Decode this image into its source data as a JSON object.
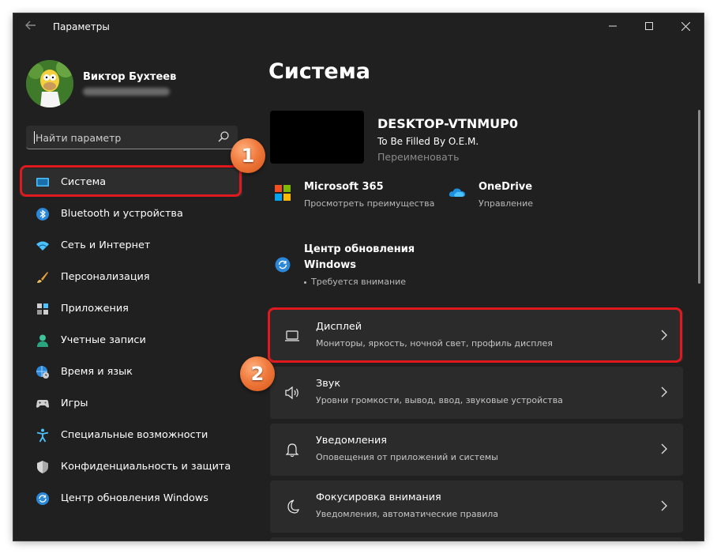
{
  "window": {
    "title": "Параметры"
  },
  "user": {
    "name": "Виктор Бухтеев"
  },
  "search": {
    "placeholder": "Найти параметр"
  },
  "sidebar": {
    "items": [
      {
        "label": "Система",
        "icon": "display-icon"
      },
      {
        "label": "Bluetooth и устройства",
        "icon": "bluetooth-icon"
      },
      {
        "label": "Сеть и Интернет",
        "icon": "wifi-icon"
      },
      {
        "label": "Персонализация",
        "icon": "brush-icon"
      },
      {
        "label": "Приложения",
        "icon": "apps-icon"
      },
      {
        "label": "Учетные записи",
        "icon": "person-icon"
      },
      {
        "label": "Время и язык",
        "icon": "globe-clock-icon"
      },
      {
        "label": "Игры",
        "icon": "gamepad-icon"
      },
      {
        "label": "Специальные возможности",
        "icon": "accessibility-icon"
      },
      {
        "label": "Конфиденциальность и защита",
        "icon": "shield-icon"
      },
      {
        "label": "Центр обновления Windows",
        "icon": "update-icon"
      }
    ]
  },
  "main": {
    "title": "Система",
    "pc": {
      "name": "DESKTOP-VTNMUP0",
      "model": "To Be Filled By O.E.M.",
      "rename": "Переименовать"
    },
    "tiles": {
      "m365": {
        "title": "Microsoft 365",
        "sub": "Просмотреть преимущества"
      },
      "onedrive": {
        "title": "OneDrive",
        "sub": "Управление"
      },
      "update": {
        "title_line1": "Центр обновления",
        "title_line2": "Windows",
        "sub": "Требуется внимание"
      }
    },
    "cards": [
      {
        "title": "Дисплей",
        "sub": "Мониторы, яркость, ночной свет, профиль дисплея"
      },
      {
        "title": "Звук",
        "sub": "Уровни громкости, вывод, ввод, звуковые устройства"
      },
      {
        "title": "Уведомления",
        "sub": "Оповещения от приложений и системы"
      },
      {
        "title": "Фокусировка внимания",
        "sub": "Уведомления, автоматические правила"
      }
    ]
  },
  "annotations": {
    "badge1": "1",
    "badge2": "2"
  },
  "colors": {
    "accent": "#4cc2ff",
    "highlight": "#e0191f",
    "badge": "#f07a3e",
    "background": "#202020"
  }
}
